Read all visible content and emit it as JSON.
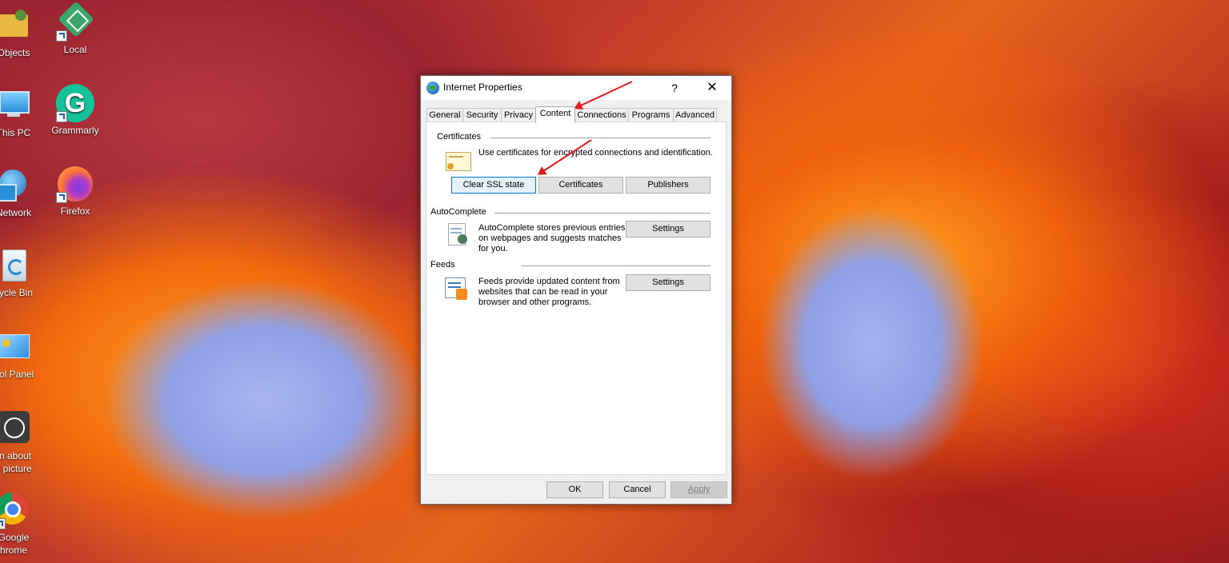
{
  "desktop": {
    "icons": [
      {
        "label": "Objects"
      },
      {
        "label": "Local"
      },
      {
        "label": "This PC"
      },
      {
        "label": "Grammarly"
      },
      {
        "label": "Network"
      },
      {
        "label": "Firefox"
      },
      {
        "label": "cycle Bin"
      },
      {
        "label": "trol Panel"
      },
      {
        "label": "rn about\ns picture"
      },
      {
        "label": "Google\nhrome"
      }
    ]
  },
  "dialog": {
    "title": "Internet Properties",
    "help": "?",
    "close": "✕",
    "tabs": [
      {
        "label": "General"
      },
      {
        "label": "Security"
      },
      {
        "label": "Privacy"
      },
      {
        "label": "Content",
        "active": true
      },
      {
        "label": "Connections"
      },
      {
        "label": "Programs"
      },
      {
        "label": "Advanced"
      }
    ],
    "certificates": {
      "heading": "Certificates",
      "description": "Use certificates for encrypted connections and identification.",
      "buttons": [
        "Clear SSL state",
        "Certificates",
        "Publishers"
      ]
    },
    "autocomplete": {
      "heading": "AutoComplete",
      "description": "AutoComplete stores previous entries on webpages and suggests matches for you.",
      "settings": "Settings"
    },
    "feeds": {
      "heading": "Feeds",
      "description": "Feeds provide updated content from websites that can be read in your browser and other programs.",
      "settings": "Settings"
    },
    "footer": {
      "ok": "OK",
      "cancel": "Cancel",
      "apply": "Apply"
    }
  },
  "annotations": {
    "arrow_color": "#e31a1a"
  }
}
